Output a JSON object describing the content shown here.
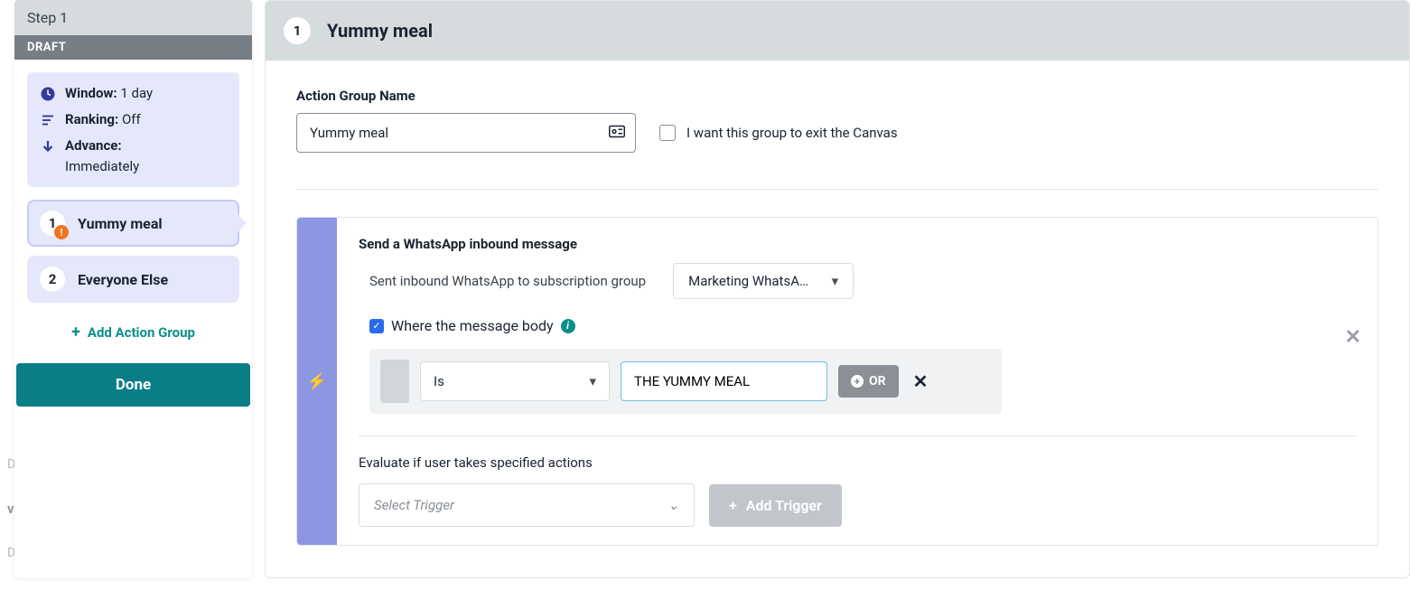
{
  "background": {
    "delay": "Delay",
    "controls": "v Controls",
    "decision": "Decision Split"
  },
  "sidebar": {
    "step_title": "Step 1",
    "draft": "DRAFT",
    "summary": {
      "window_label": "Window:",
      "window_val": "1 day",
      "ranking_label": "Ranking:",
      "ranking_val": "Off",
      "advance_label": "Advance:",
      "advance_val": "Immediately"
    },
    "items": [
      {
        "num": "1",
        "label": "Yummy meal",
        "alert": "!"
      },
      {
        "num": "2",
        "label": "Everyone Else"
      }
    ],
    "add_group": "Add Action Group",
    "done": "Done"
  },
  "main": {
    "header_num": "1",
    "header_title": "Yummy meal",
    "name_label": "Action Group Name",
    "name_value": "Yummy meal",
    "exit_label": "I want this group to exit the Canvas",
    "trigger": {
      "title": "Send a WhatsApp inbound message",
      "sub": "Sent inbound WhatsApp to subscription group",
      "group_selected": "Marketing WhatsA…",
      "msg_body_label": "Where the message body",
      "cond_op": "Is",
      "cond_val": "THE YUMMY MEAL",
      "or": "OR"
    },
    "eval_label": "Evaluate if user takes specified actions",
    "select_trigger_placeholder": "Select Trigger",
    "add_trigger": "Add Trigger"
  }
}
